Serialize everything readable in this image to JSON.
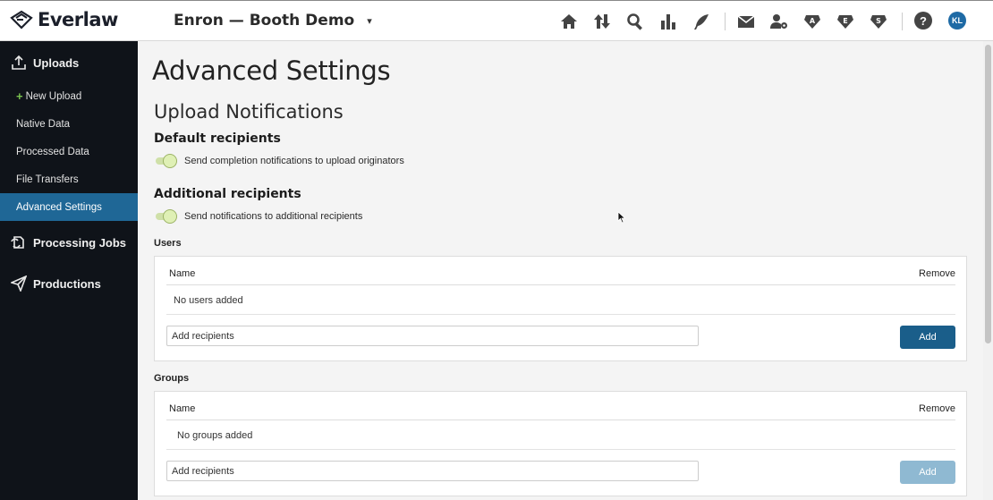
{
  "brand": {
    "name": "Everlaw"
  },
  "project": {
    "name": "Enron — Booth Demo",
    "caret": "▾"
  },
  "toolbar": {
    "icons": [
      "home-icon",
      "sort-arrows-icon",
      "search-icon",
      "bar-chart-icon",
      "quill-icon",
      "mail-icon",
      "user-gear-icon",
      "badge-a-icon",
      "badge-e-icon",
      "badge-s-icon",
      "help-icon",
      "avatar"
    ],
    "badge_a": "A",
    "badge_e": "E",
    "badge_s": "S",
    "help": "?",
    "avatar_initials": "KL"
  },
  "sidebar": {
    "uploads": "Uploads",
    "items": [
      {
        "label": "New Upload",
        "prefix": "+"
      },
      {
        "label": "Native Data"
      },
      {
        "label": "Processed Data"
      },
      {
        "label": "File Transfers"
      },
      {
        "label": "Advanced Settings",
        "active": true
      }
    ],
    "processing_jobs": "Processing Jobs",
    "productions": "Productions"
  },
  "main": {
    "title": "Advanced Settings",
    "section_title": "Upload Notifications",
    "default_recipients": {
      "heading": "Default recipients",
      "toggle_label": "Send completion notifications to upload originators",
      "enabled": true
    },
    "additional_recipients": {
      "heading": "Additional recipients",
      "toggle_label": "Send notifications to additional recipients",
      "enabled": true
    },
    "users": {
      "label": "Users",
      "col_name": "Name",
      "col_remove": "Remove",
      "empty": "No users added",
      "input_placeholder": "Add recipients",
      "add_label": "Add"
    },
    "groups": {
      "label": "Groups",
      "col_name": "Name",
      "col_remove": "Remove",
      "empty": "No groups added",
      "input_placeholder": "Add recipients",
      "add_label": "Add"
    }
  },
  "colors": {
    "sidebar_bg": "#0f1319",
    "sidebar_active": "#1f6796",
    "primary_button": "#1a5e8a",
    "disabled_button": "#8fb9d2",
    "toggle_on": "#dff0b5"
  }
}
